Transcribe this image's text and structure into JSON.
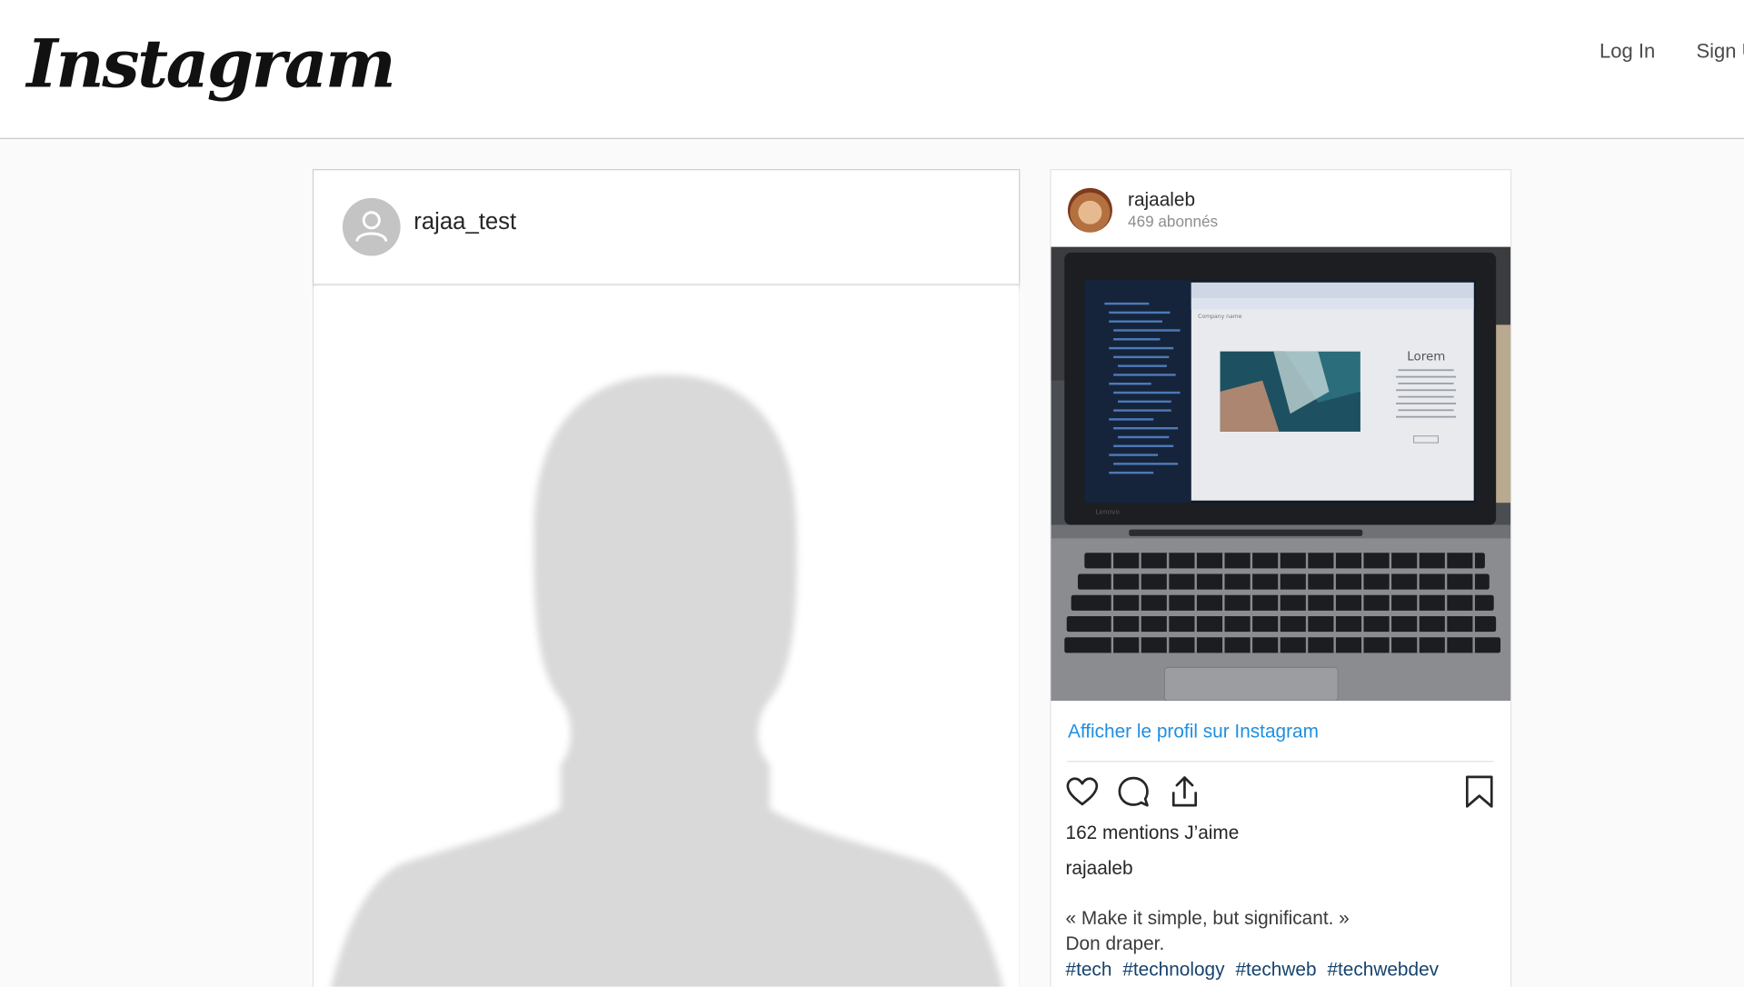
{
  "header": {
    "logo_text": "Instagram",
    "login_label": "Log In",
    "signup_label": "Sign U"
  },
  "profile_card": {
    "username": "rajaa_test"
  },
  "embed": {
    "username": "rajaaleb",
    "followers": "469 abonnés",
    "view_profile_label": "Afficher le profil sur Instagram",
    "likes": "162 mentions J’aime",
    "caption_user": "rajaaleb",
    "caption_lines": [
      "« Make it simple, but significant. »",
      "Don draper."
    ],
    "hashtags": [
      "#tech",
      "#technology",
      "#techweb",
      "#techwebdev"
    ],
    "photo_screen": {
      "company_name": "Company name",
      "hero_title": "Lorem",
      "laptop_brand": "Lenovo"
    }
  },
  "icons": [
    "heart-icon",
    "comment-icon",
    "share-icon",
    "bookmark-icon",
    "default-avatar-icon"
  ],
  "colors": {
    "link_blue": "#1f8fe0",
    "hashtag_blue": "#17436e",
    "page_bg": "#fafafa"
  }
}
